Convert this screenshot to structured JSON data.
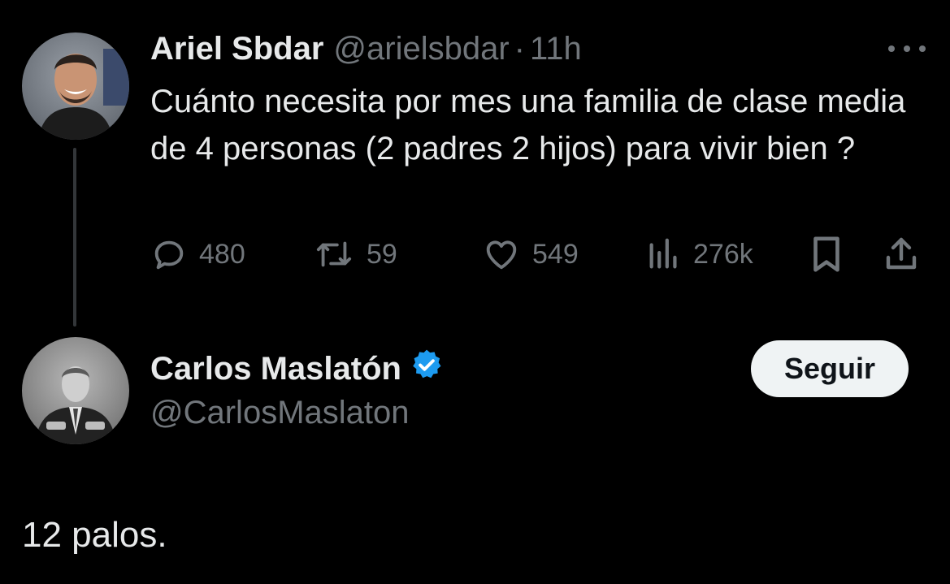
{
  "original_tweet": {
    "author_name": "Ariel Sbdar",
    "handle": "@arielsbdar",
    "separator": "·",
    "time": "11h",
    "text": "Cuánto necesita por mes una familia de clase media de 4 personas (2 padres 2 hijos) para vivir bien ?",
    "replies": "480",
    "retweets": "59",
    "likes": "549",
    "views": "276k",
    "more_icon": "ellipsis-icon",
    "avatar": "profile-photo-man-smiling"
  },
  "reply_tweet": {
    "author_name": "Carlos Maslatón",
    "handle": "@CarlosMaslaton",
    "verified_icon": "verified-badge-icon",
    "follow_label": "Seguir",
    "text": "12 palos.",
    "avatar": "profile-photo-man-in-suit-bw"
  },
  "colors": {
    "background": "#000000",
    "text_primary": "#e7e9ea",
    "text_secondary": "#71767b",
    "verified_blue": "#1d9bf0",
    "follow_button_bg": "#eff3f4",
    "thread_line": "#333639"
  }
}
